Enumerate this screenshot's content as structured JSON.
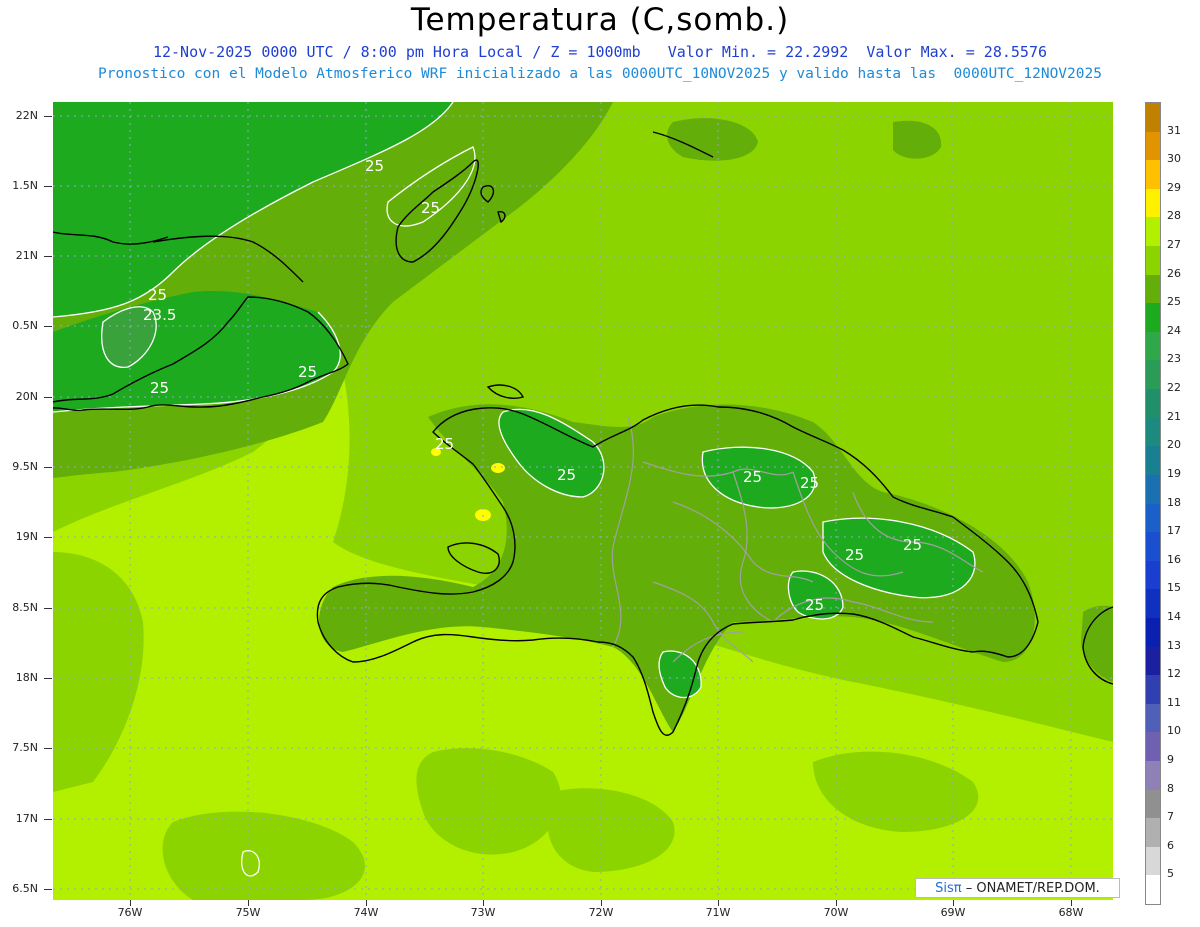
{
  "header": {
    "title": "Temperatura (C,somb.)",
    "line1": "12-Nov-2025 0000 UTC / 8:00 pm Hora Local / Z = 1000mb   Valor Min. = 22.2992  Valor Max. = 28.5576",
    "line2": "Pronostico con el Modelo Atmosferico WRF inicializado a las 0000UTC_10NOV2025 y valido hasta las  0000UTC_12NOV2025"
  },
  "map": {
    "lat_labels": [
      "22N",
      "1.5N",
      "21N",
      "0.5N",
      "20N",
      "9.5N",
      "19N",
      "8.5N",
      "18N",
      "7.5N",
      "17N",
      "6.5N"
    ],
    "lon_labels": [
      "76W",
      "75W",
      "74W",
      "73W",
      "72W",
      "71W",
      "70W",
      "69W",
      "68W"
    ],
    "contour_labels": [
      "25",
      "25",
      "25",
      "23.5",
      "25",
      "25",
      "25",
      "25",
      "25",
      "25",
      "25",
      "25",
      "25"
    ],
    "fill_colors": {
      "t23": "#3aa23a",
      "t24": "#1eaa1e",
      "t25": "#64ae0a",
      "t26": "#8cd400",
      "t27": "#b3f000",
      "t28": "#fffd00",
      "coast": "#000000",
      "borders": "#a0a0a0",
      "contour": "#ffffff",
      "grid": "#9aa0d8"
    }
  },
  "colorbar": {
    "labels": [
      "31",
      "30",
      "29",
      "28",
      "27",
      "26",
      "25",
      "24",
      "23",
      "22",
      "21",
      "20",
      "19",
      "18",
      "17",
      "16",
      "15",
      "14",
      "13",
      "12",
      "11",
      "10",
      "9",
      "8",
      "7",
      "6",
      "5"
    ],
    "colors": [
      "#c08000",
      "#e29400",
      "#ffc000",
      "#fff000",
      "#b3f000",
      "#8cd400",
      "#64ae0a",
      "#1eaa1e",
      "#2ea848",
      "#2a9c58",
      "#20906a",
      "#1c8a7e",
      "#188090",
      "#1a70b0",
      "#1a60c8",
      "#1a50d0",
      "#1a3ed0",
      "#1030c0",
      "#0a20b0",
      "#1a20a0",
      "#3040b0",
      "#5060b8",
      "#7060b0",
      "#9080b8",
      "#909090",
      "#b0b0b0",
      "#d8d8d8",
      "#ffffff"
    ]
  },
  "credit": {
    "brand": "Sisπ",
    "rest": "– ONAMET/REP.DOM."
  }
}
